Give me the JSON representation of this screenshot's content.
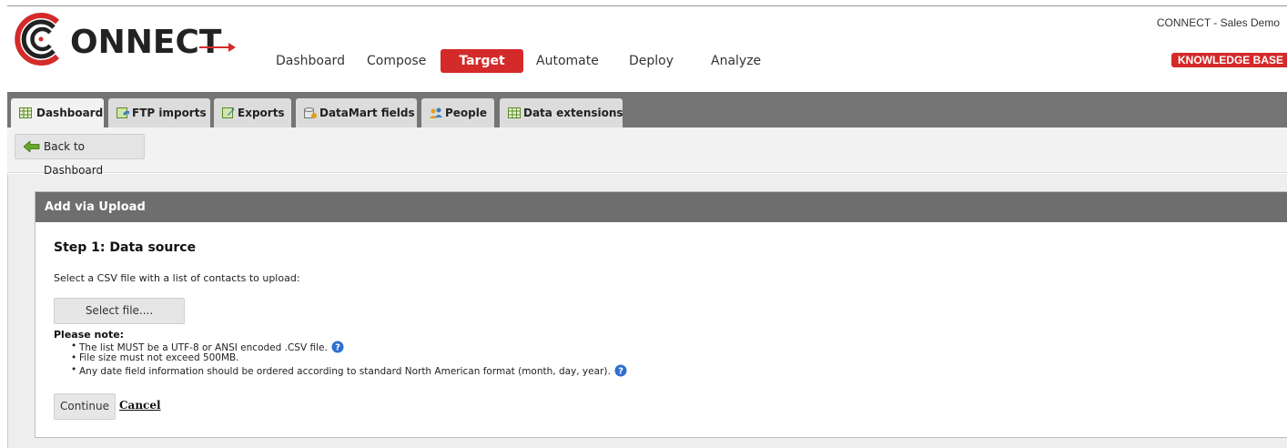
{
  "brand": {
    "logo_text": "ONNECT"
  },
  "nav": {
    "items": [
      {
        "label": "Dashboard"
      },
      {
        "label": "Compose"
      },
      {
        "label": "Target"
      },
      {
        "label": "Automate"
      },
      {
        "label": "Deploy"
      },
      {
        "label": "Analyze"
      }
    ],
    "active": "Target"
  },
  "header": {
    "account_label": "CONNECT - Sales Demo",
    "knowledge_base_label": "KNOWLEDGE BASE"
  },
  "tabs": [
    {
      "label": "Dashboard",
      "icon": "table-icon",
      "active": true
    },
    {
      "label": "FTP imports",
      "icon": "import-icon",
      "active": false
    },
    {
      "label": "Exports",
      "icon": "export-icon",
      "active": false
    },
    {
      "label": "DataMart fields",
      "icon": "database-icon",
      "active": false
    },
    {
      "label": "People",
      "icon": "people-icon",
      "active": false
    },
    {
      "label": "Data extensions",
      "icon": "table-icon",
      "active": false
    }
  ],
  "toolbar": {
    "back_label": "Back to Dashboard"
  },
  "panel": {
    "title": "Add via Upload",
    "step_title": "Step 1: Data source",
    "description": "Select a CSV file with a list of contacts to upload:",
    "select_file_label": "Select file....",
    "note_label": "Please note:",
    "notes": [
      "The list MUST be a UTF-8 or ANSI encoded .CSV file.",
      "File size must not exceed 500MB.",
      "Any date field information should be ordered according to standard North American format (month, day, year)."
    ],
    "continue_label": "Continue",
    "cancel_label": "Cancel"
  },
  "colors": {
    "accent_red": "#d42a2a",
    "tab_bar": "#747474",
    "panel_header": "#6e6e6e"
  }
}
